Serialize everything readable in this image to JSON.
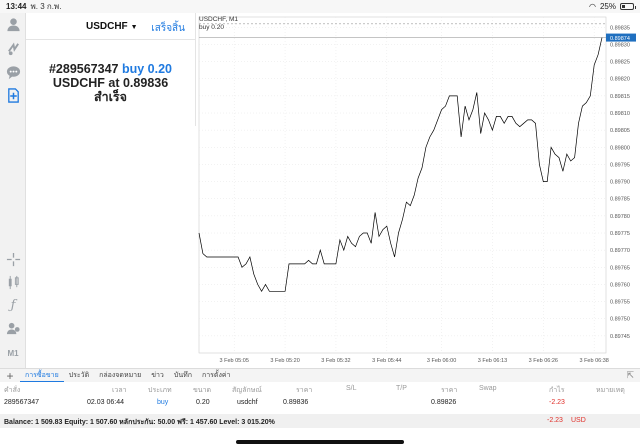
{
  "status_bar": {
    "time": "13:44",
    "date": "พ. 3 ก.พ.",
    "battery": "25%"
  },
  "order_panel": {
    "symbol": "USDCHF",
    "done_label": "เสร็จสิ้น",
    "ticket": "#289567347",
    "action": "buy 0.20",
    "result_prefix": "USDCHF at",
    "price": "0.89836",
    "status": "สำเร็จ"
  },
  "chart": {
    "header_symbol": "USDCHF, M1",
    "order_label": "buy 0.20",
    "current_price_label": "0.89874",
    "colors": {
      "line": "#000000",
      "grid": "#e6e6e6",
      "price_marker": "#1f6fbf"
    }
  },
  "chart_data": {
    "type": "line",
    "ylim": [
      0.8974,
      0.89838
    ],
    "yticks": [
      "0.89835",
      "0.89830",
      "0.89825",
      "0.89820",
      "0.89815",
      "0.89810",
      "0.89805",
      "0.89800",
      "0.89795",
      "0.89790",
      "0.89785",
      "0.89780",
      "0.89775",
      "0.89770",
      "0.89765",
      "0.89760",
      "0.89755",
      "0.89750",
      "0.89745"
    ],
    "xticks": [
      "3 Feb 05:05",
      "3 Feb 05:20",
      "3 Feb 05:32",
      "3 Feb 05:44",
      "3 Feb 06:00",
      "3 Feb 06:13",
      "3 Feb 06:26",
      "3 Feb 06:38"
    ],
    "series": [
      {
        "values": [
          0.89775,
          0.89769,
          0.89768,
          0.89768,
          0.89768,
          0.89768,
          0.89768,
          0.89768,
          0.89768,
          0.89768,
          0.89768,
          0.89765,
          0.89766,
          0.89768,
          0.89763,
          0.8976,
          0.89758,
          0.8976,
          0.89758,
          0.89758,
          0.89758,
          0.89758,
          0.89758,
          0.89766,
          0.89766,
          0.89766,
          0.89766,
          0.89766,
          0.89767,
          0.89766,
          0.89766,
          0.8977,
          0.89766,
          0.89766,
          0.89766,
          0.89766,
          0.89773,
          0.8977,
          0.89774,
          0.89772,
          0.89771,
          0.89774,
          0.89775,
          0.89775,
          0.89772,
          0.89781,
          0.89774,
          0.89776,
          0.89777,
          0.89772,
          0.89768,
          0.89775,
          0.89779,
          0.89784,
          0.89783,
          0.89786,
          0.89791,
          0.89794,
          0.898,
          0.89803,
          0.89805,
          0.89808,
          0.89811,
          0.89812,
          0.89815,
          0.89815,
          0.89815,
          0.89803,
          0.89812,
          0.89808,
          0.89811,
          0.89816,
          0.89804,
          0.8981,
          0.89808,
          0.89805,
          0.89809,
          0.89809,
          0.89807,
          0.89809,
          0.89809,
          0.89807,
          0.89806,
          0.89807,
          0.89808,
          0.89808,
          0.89807,
          0.89795,
          0.8979,
          0.8979,
          0.898,
          0.89798,
          0.89797,
          0.89793,
          0.89798,
          0.89796,
          0.89797,
          0.89807,
          0.89812,
          0.89813,
          0.89815,
          0.89824,
          0.89827,
          0.89832
        ]
      }
    ]
  },
  "bottom_tabs": [
    "การซื้อขาย",
    "ประวัติ",
    "กล่องจดหมาย",
    "ข่าว",
    "บันทึก",
    "การตั้งค่า"
  ],
  "trade_table": {
    "headers": [
      "คำสั่ง",
      "เวลา",
      "ประเภท",
      "ขนาด",
      "สัญลักษณ์",
      "ราคา",
      "S/L",
      "T/P",
      "ราคา",
      "Swap",
      "กำไร",
      "หมายเหตุ"
    ],
    "rows": [
      {
        "order": "289567347",
        "time": "02.03 06:44",
        "type": "buy",
        "size": "0.20",
        "symbol": "usdchf",
        "open_price": "0.89836",
        "current_price": "0.89826",
        "profit": "-2.23"
      }
    ]
  },
  "balance": {
    "text": "Balance: 1 509.83 Equity: 1 507.60 หลักประกัน: 50.00 ฟรี: 1 457.60 Level: 3 015.20%",
    "total": "-2.23",
    "currency": "USD"
  }
}
